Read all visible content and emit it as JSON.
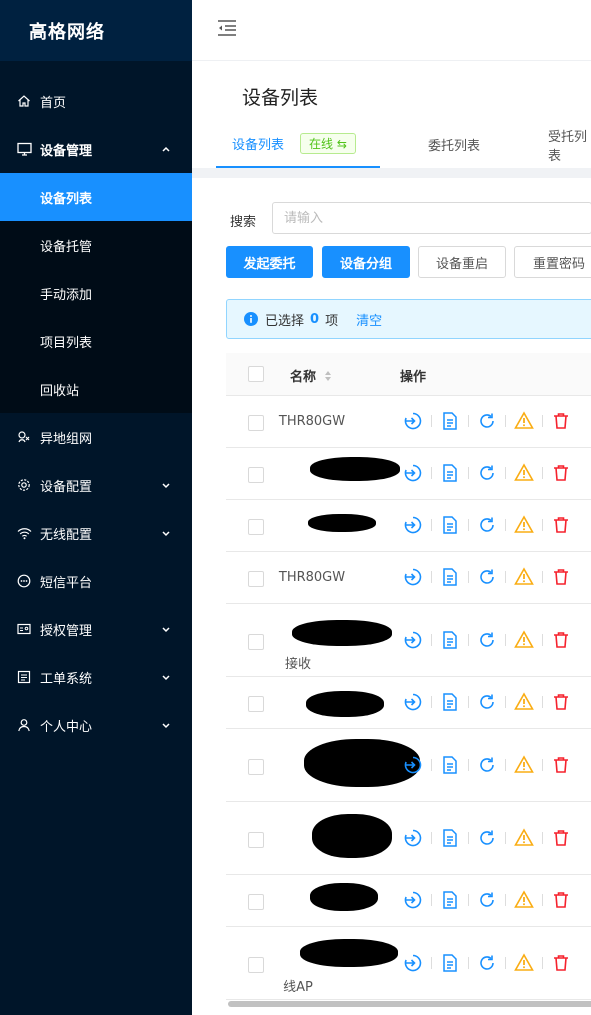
{
  "app": {
    "logo_text": "高格网络"
  },
  "sidebar": {
    "home": "首页",
    "device_mgmt": "设备管理",
    "sub": [
      "设备列表",
      "设备托管",
      "手动添加",
      "项目列表",
      "回收站"
    ],
    "remote_net": "异地组网",
    "device_config": "设备配置",
    "wireless_config": "无线配置",
    "sms": "短信平台",
    "license": "授权管理",
    "ticket": "工单系统",
    "personal": "个人中心"
  },
  "page": {
    "title": "设备列表",
    "tabs": [
      "设备列表",
      "委托列表",
      "受托列表"
    ],
    "online_badge": "在线 ⇆"
  },
  "search": {
    "label": "搜索",
    "placeholder": "请输入"
  },
  "buttons": {
    "delegate": "发起委托",
    "group": "设备分组",
    "reboot": "设备重启",
    "reset_password": "重置密码"
  },
  "alert": {
    "prefix": "已选择",
    "count": "0",
    "suffix": "项",
    "clear": "清空"
  },
  "table": {
    "headers": {
      "name": "名称",
      "ops": "操作"
    },
    "rows": [
      {
        "name": "THR80GW",
        "redacted": false
      },
      {
        "name": "",
        "redacted": true
      },
      {
        "name": "",
        "redacted": true
      },
      {
        "name": "THR80GW",
        "redacted": false
      },
      {
        "name": "接收",
        "redacted": true
      },
      {
        "name": "",
        "redacted": true
      },
      {
        "name": "",
        "redacted": true
      },
      {
        "name": "",
        "redacted": true
      },
      {
        "name": "",
        "redacted": true
      },
      {
        "name": "线AP",
        "redacted": true
      }
    ]
  },
  "colors": {
    "sidebar_bg": "#001529",
    "accent": "#1890ff",
    "warning": "#faad14",
    "danger": "#f5222d",
    "success": "#52c41a"
  }
}
